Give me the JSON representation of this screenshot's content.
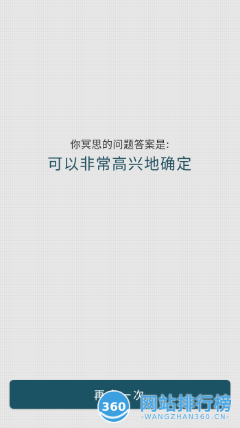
{
  "result": {
    "prompt": "你冥思的问题答案是:",
    "answer": "可以非常高兴地确定"
  },
  "bottom_button": {
    "label": "再来一次"
  },
  "watermark": {
    "logo_text": "360",
    "title": "网站排行榜",
    "subtitle": "-WANGZHAN360.CN-"
  },
  "colors": {
    "background": "#e8e8e8",
    "prompt_text": "#2e2e2e",
    "answer_text": "#1f4f5e",
    "button_bg": "#1c5364",
    "watermark": "#4aa7e6"
  }
}
